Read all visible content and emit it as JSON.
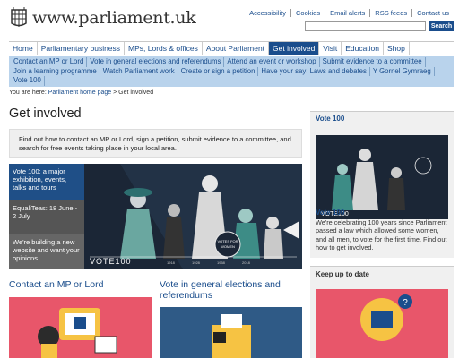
{
  "header": {
    "site_name": "www.parliament.uk",
    "util_links": [
      "Accessibility",
      "Cookies",
      "Email alerts",
      "RSS feeds",
      "Contact us"
    ],
    "search_button": "Search",
    "search_value": ""
  },
  "main_nav": [
    "Home",
    "Parliamentary business",
    "MPs, Lords & offices",
    "About Parliament",
    "Get involved",
    "Visit",
    "Education",
    "Shop"
  ],
  "main_nav_active": "Get involved",
  "sub_nav": [
    "Contact an MP or Lord",
    "Vote in general elections and referendums",
    "Attend an event or workshop",
    "Submit evidence to a committee",
    "Join a learning programme",
    "Watch Parliament work",
    "Create or sign a petition",
    "Have your say: Laws and debates",
    "Y Gornel Gymraeg",
    "Vote 100"
  ],
  "breadcrumb": {
    "prefix": "You are here:",
    "home": "Parliament home page",
    "sep": ">",
    "current": "Get involved"
  },
  "page_title": "Get involved",
  "intro": "Find out how to contact an MP or Lord, sign a petition, submit evidence to a committee, and search for free events taking place in your local area.",
  "carousel": {
    "tabs": [
      "Vote 100: a major exhibition, events, talks and tours",
      "EqualiTeas: 18 June - 2 July",
      "We're building a new website and want your opinions"
    ],
    "banner_text": "VOTE100",
    "badge_text": "VOTES FOR WOMEN",
    "years": [
      "1918",
      "1928",
      "1958",
      "2018"
    ]
  },
  "sections": {
    "contact_heading": "Contact an MP or Lord",
    "vote_heading": "Vote in general elections and referendums"
  },
  "sidebar": {
    "box1_title": "Vote 100",
    "box1_link": "Vote 100",
    "box1_text": "We're celebrating 100 years since Parliament passed a law which allowed some women, and all men, to vote for the first time. Find out how to get involved.",
    "box1_banner": "VOTE100",
    "box2_title": "Keep up to date"
  },
  "colors": {
    "brand_blue": "#1a4d8c",
    "subnav_bg": "#b9d3ec",
    "accent_pink": "#e8566a",
    "accent_yellow": "#f6c343",
    "dark_teal": "#1e2a3c"
  }
}
